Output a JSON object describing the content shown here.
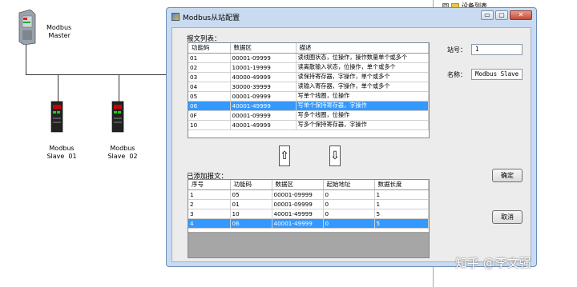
{
  "diagram": {
    "master_label": "Modbus\n Master",
    "slave1_label": "Modbus\nSlave  01",
    "slave2_label": "Modbus\nSlave  02"
  },
  "tree": {
    "item_label": "设备列表",
    "expander": "⊟"
  },
  "dialog": {
    "title": "Modbus从站配置",
    "min_glyph": "▭",
    "max_glyph": "▢",
    "close_glyph": "✕"
  },
  "message_list": {
    "label": "报文列表：",
    "headers": [
      "功能码",
      "数据区",
      "描述"
    ],
    "rows": [
      [
        "01",
        "00001-09999",
        "读线圈状态，位操作，操作数量单个或多个"
      ],
      [
        "02",
        "10001-19999",
        "读离散输入状态，位操作，单个或多个"
      ],
      [
        "03",
        "40000-49999",
        "读保持寄存器，字操作，单个或多个"
      ],
      [
        "04",
        "30000-39999",
        "读输入寄存器，字操作，单个或多个"
      ],
      [
        "05",
        "00001-09999",
        "写单个线圈，位操作"
      ],
      [
        "06",
        "40001-49999",
        "写单个保持寄存器，字操作"
      ],
      [
        "0F",
        "00001-09999",
        "写多个线圈，位操作"
      ],
      [
        "10",
        "40001-49999",
        "写多个保持寄存器，字操作"
      ]
    ],
    "selected_row": 5
  },
  "added_list": {
    "label": "已添加报文：",
    "headers": [
      "序号",
      "功能码",
      "数据区",
      "起始地址",
      "数据长度"
    ],
    "rows": [
      [
        "1",
        "05",
        "00001-09999",
        "0",
        "1"
      ],
      [
        "2",
        "01",
        "00001-09999",
        "0",
        "1"
      ],
      [
        "3",
        "10",
        "40001-49999",
        "0",
        "5"
      ],
      [
        "4",
        "06",
        "40001-49999",
        "0",
        "5"
      ]
    ],
    "selected_row": 3
  },
  "arrows": {
    "up": "⇧",
    "down": "⇩"
  },
  "form": {
    "station_label": "站号：",
    "station_value": "1",
    "name_label": "名称：",
    "name_value": "Modbus Slave"
  },
  "buttons": {
    "ok": "确定",
    "cancel": "取消"
  },
  "watermark": "知乎 @李文强"
}
